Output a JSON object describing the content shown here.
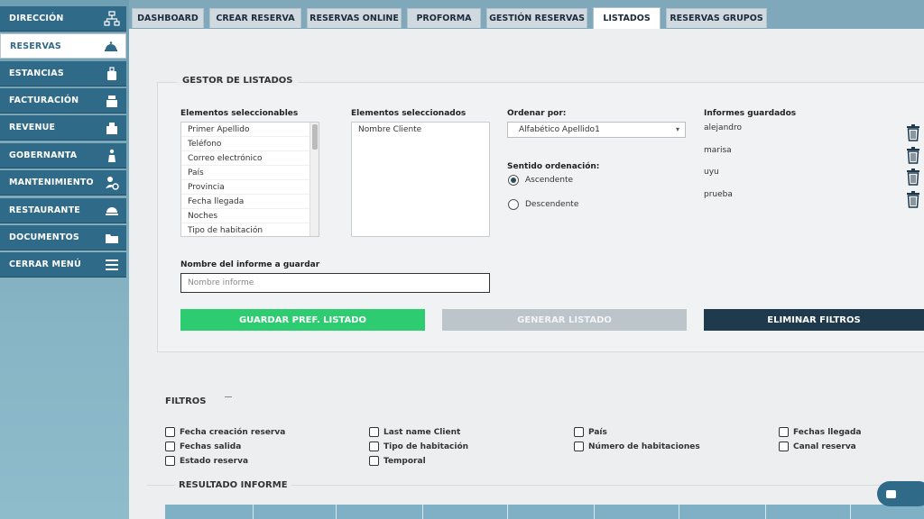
{
  "sidebar": {
    "items": [
      {
        "label": "DIRECCIÓN",
        "icon": "org-chart-icon"
      },
      {
        "label": "RESERVAS",
        "icon": "reception-bell-icon",
        "active": true
      },
      {
        "label": "ESTANCIAS",
        "icon": "luggage-icon"
      },
      {
        "label": "FACTURACIÓN",
        "icon": "cash-register-icon"
      },
      {
        "label": "REVENUE",
        "icon": "chart-icon"
      },
      {
        "label": "GOBERNANTA",
        "icon": "housekeeper-icon"
      },
      {
        "label": "MANTENIMIENTO",
        "icon": "maintenance-gear-icon"
      },
      {
        "label": "RESTAURANTE",
        "icon": "chef-hat-icon"
      },
      {
        "label": "DOCUMENTOS",
        "icon": "folder-icon"
      },
      {
        "label": "CERRAR MENÚ",
        "icon": "hamburger-menu-icon"
      }
    ]
  },
  "tabs": [
    {
      "label": "DASHBOARD"
    },
    {
      "label": "CREAR RESERVA"
    },
    {
      "label": "RESERVAS ONLINE"
    },
    {
      "label": "PROFORMA"
    },
    {
      "label": "GESTIÓN RESERVAS"
    },
    {
      "label": "LISTADOS",
      "active": true
    },
    {
      "label": "RESERVAS GRUPOS"
    }
  ],
  "gestor": {
    "title": "GESTOR DE LISTADOS",
    "selectable_label": "Elementos seleccionables",
    "selectable_items": [
      "Primer Apellido",
      "Teléfono",
      "Correo electrónico",
      "País",
      "Provincia",
      "Fecha llegada",
      "Noches",
      "Tipo de habitación"
    ],
    "selected_label": "Elementos seleccionados",
    "selected_items": [
      "Nombre Cliente"
    ],
    "order_label": "Ordenar por:",
    "order_value": "Alfabético Apellido1",
    "direction_label": "Sentido ordenación:",
    "direction_options": [
      "Ascendente",
      "Descendente"
    ],
    "direction_selected": "Ascendente",
    "saved_label": "Informes guardados",
    "saved_reports": [
      "alejandro",
      "marisa",
      "uyu",
      "prueba"
    ],
    "report_name_label": "Nombre del informe a guardar",
    "report_name_placeholder": "Nombre informe",
    "btn_save": "GUARDAR PREF. LISTADO",
    "btn_generate": "GENERAR LISTADO",
    "btn_clear": "ELIMINAR FILTROS"
  },
  "filters": {
    "title": "FILTROS",
    "items": [
      "Fecha creación reserva",
      "Last name Client",
      "País",
      "Fechas llegada",
      "Fechas salida",
      "Tipo de habitación",
      "Número de habitaciones",
      "Canal reserva",
      "Estado reserva",
      "Temporal"
    ]
  },
  "result": {
    "title": "RESULTADO INFORME"
  },
  "colors": {
    "sidebar_item": "#2f6a88",
    "green": "#2ecc71",
    "dark": "#1f3a4d",
    "disabled": "#bcc5ca"
  }
}
